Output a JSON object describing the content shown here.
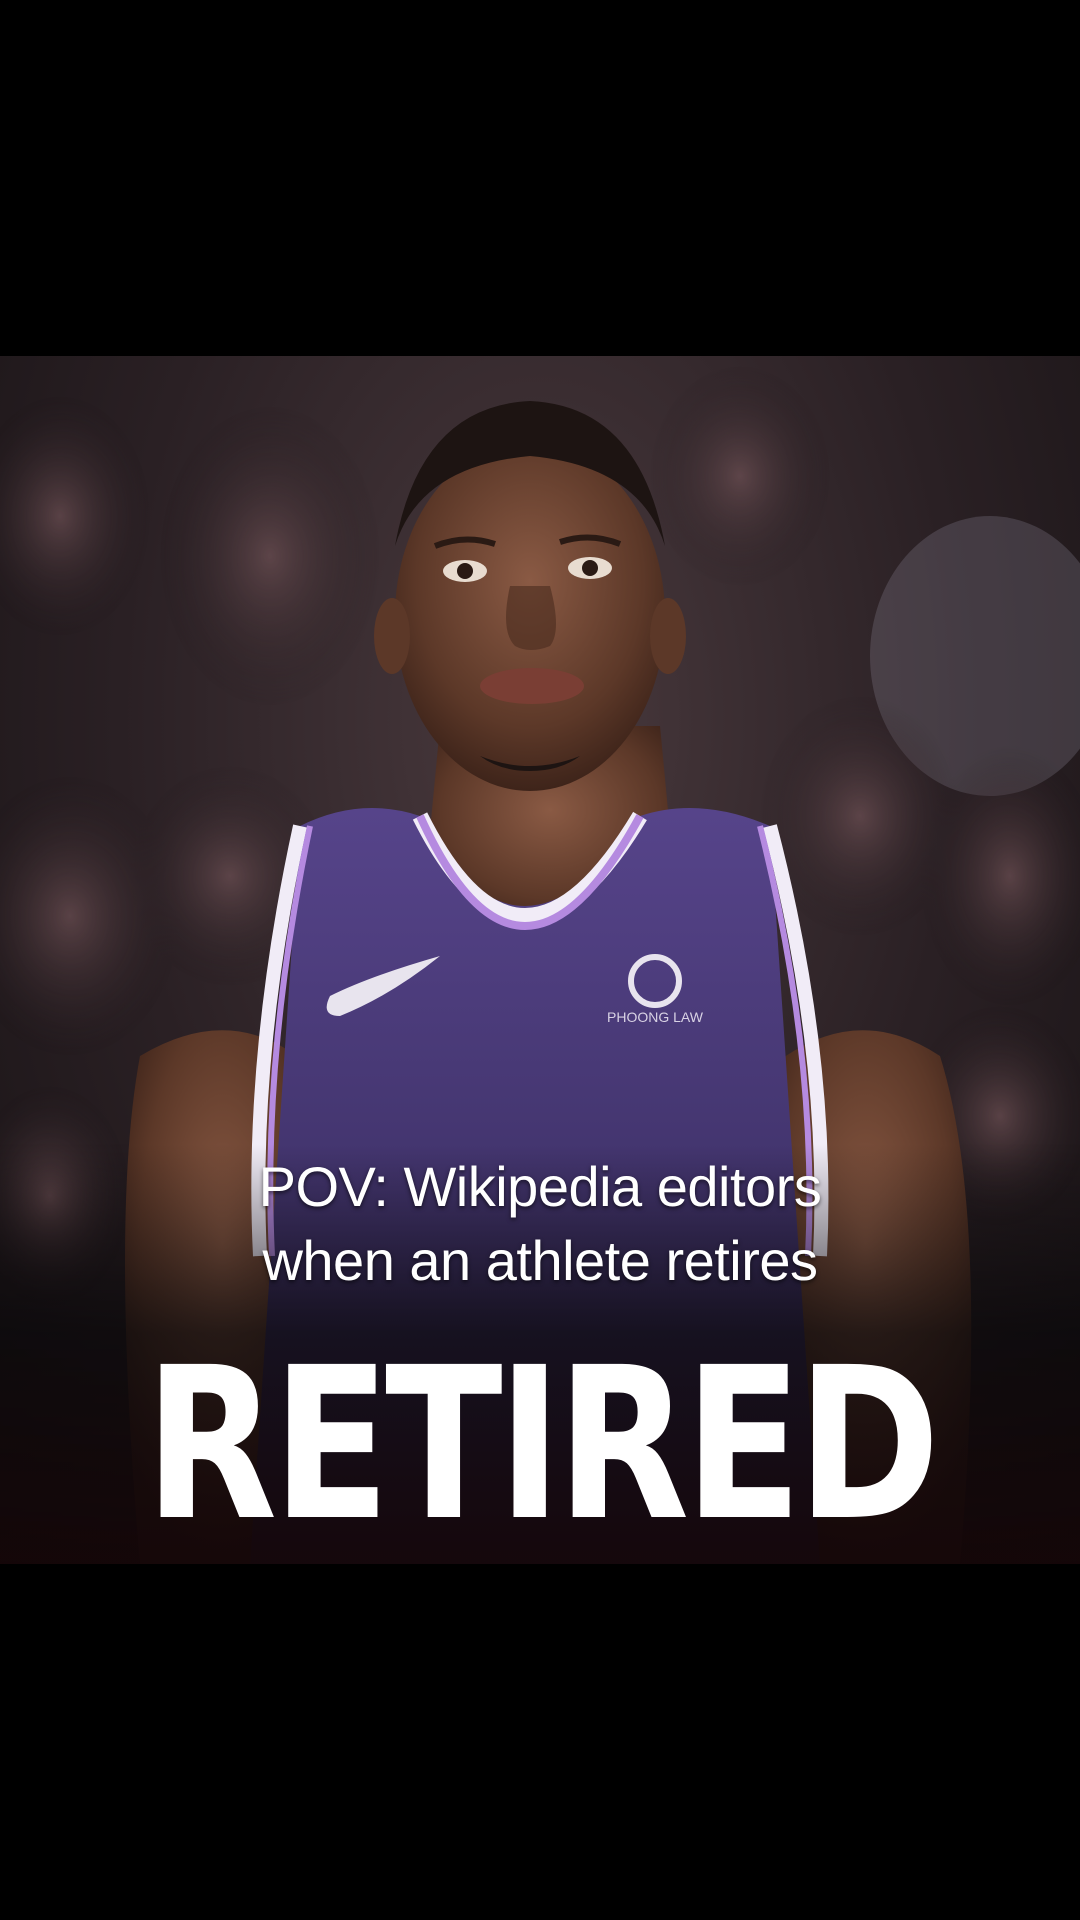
{
  "overlay": {
    "caption_line_1": "POV: Wikipedia editors",
    "caption_line_2": "when an athlete retires",
    "headline": "RETIRED"
  },
  "jersey": {
    "sponsor_text": "PHOONG LAW",
    "color": "#4b3a78",
    "trim_color": "#b58ae0"
  }
}
